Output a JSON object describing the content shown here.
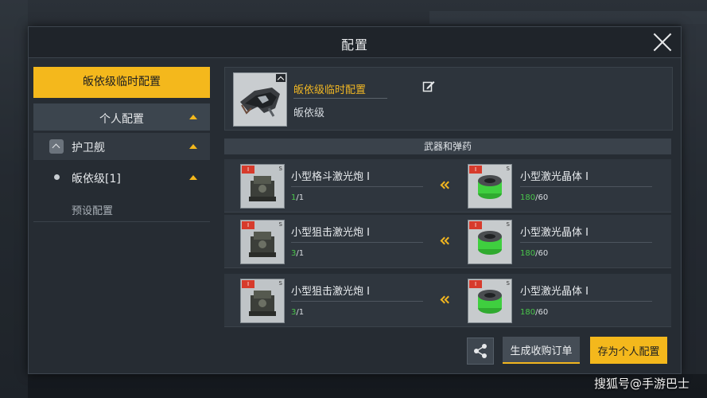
{
  "window": {
    "title": "配置"
  },
  "left_panel": {
    "temp_config_button": "皈依级临时配置",
    "personal_config_header": "个人配置",
    "ship_class": "护卫舰",
    "ship_item": "皈依级[1]",
    "preset_config": "预设配置"
  },
  "header": {
    "config_name": "皈依级临时配置",
    "ship_name": "皈依级"
  },
  "weapons": {
    "section_title": "武器和弹药",
    "rows": [
      {
        "weapon_name": "小型格斗激光炮 I",
        "weapon_count_have": "1",
        "weapon_count_sep": "/1",
        "ammo_name": "小型激光晶体 I",
        "ammo_count_have": "180",
        "ammo_count_sep": "/60"
      },
      {
        "weapon_name": "小型狙击激光炮 I",
        "weapon_count_have": "3",
        "weapon_count_sep": "/1",
        "ammo_name": "小型激光晶体 I",
        "ammo_count_have": "180",
        "ammo_count_sep": "/60"
      },
      {
        "weapon_name": "小型狙击激光炮 I",
        "weapon_count_have": "3",
        "weapon_count_sep": "/1",
        "ammo_name": "小型激光晶体 I",
        "ammo_count_have": "180",
        "ammo_count_sep": "/60"
      }
    ]
  },
  "actions": {
    "order_button": "生成收购订单",
    "save_button": "存为个人配置"
  },
  "watermark": "搜狐号@手游巴士",
  "colors": {
    "accent": "#f4b81c",
    "count_ok": "#49c64a",
    "panel": "#262c33"
  }
}
